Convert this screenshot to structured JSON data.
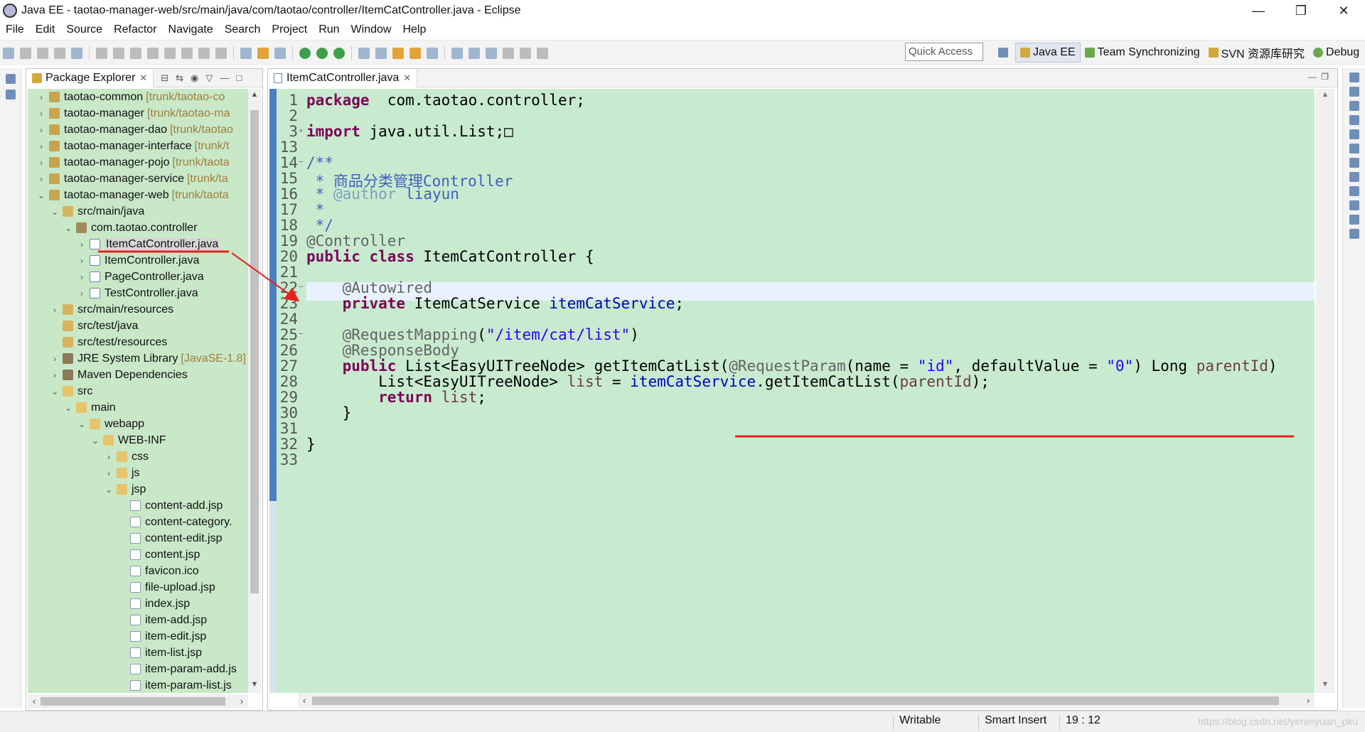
{
  "window": {
    "title": "Java EE - taotao-manager-web/src/main/java/com/taotao/controller/ItemCatController.java - Eclipse",
    "minimize": "—",
    "restore": "❐",
    "close": "✕"
  },
  "menu": [
    "File",
    "Edit",
    "Source",
    "Refactor",
    "Navigate",
    "Search",
    "Project",
    "Run",
    "Window",
    "Help"
  ],
  "quick_access": {
    "placeholder": "Quick Access"
  },
  "perspectives": [
    "Java EE",
    "Team Synchronizing",
    "SVN 资源库研究",
    "Debug"
  ],
  "package_explorer": {
    "title": "Package Explorer",
    "rows": [
      {
        "label": "taotao-common",
        "deco": "[trunk/taotao-co",
        "icon": "project",
        "arrow": "›"
      },
      {
        "label": "taotao-manager",
        "deco": "[trunk/taotao-ma",
        "icon": "project",
        "arrow": "›"
      },
      {
        "label": "taotao-manager-dao",
        "deco": "[trunk/taotao",
        "icon": "project",
        "arrow": "›"
      },
      {
        "label": "taotao-manager-interface",
        "deco": "[trunk/t",
        "icon": "project",
        "arrow": "›"
      },
      {
        "label": "taotao-manager-pojo",
        "deco": "[trunk/taota",
        "icon": "project",
        "arrow": "›"
      },
      {
        "label": "taotao-manager-service",
        "deco": "[trunk/ta",
        "icon": "project",
        "arrow": "›"
      },
      {
        "label": "taotao-manager-web",
        "deco": "[trunk/taota",
        "icon": "project",
        "arrow": "⌄"
      },
      {
        "label": "src/main/java",
        "deco": "",
        "icon": "srcfolder",
        "arrow": "⌄"
      },
      {
        "label": "com.taotao.controller",
        "deco": "",
        "icon": "package",
        "arrow": "⌄"
      },
      {
        "label": "ItemCatController.java",
        "deco": "",
        "icon": "java",
        "arrow": "›"
      },
      {
        "label": "ItemController.java",
        "deco": "",
        "icon": "java",
        "arrow": "›"
      },
      {
        "label": "PageController.java",
        "deco": "",
        "icon": "java",
        "arrow": "›"
      },
      {
        "label": "TestController.java",
        "deco": "",
        "icon": "java",
        "arrow": "›"
      },
      {
        "label": "src/main/resources",
        "deco": "",
        "icon": "srcfolder",
        "arrow": "›"
      },
      {
        "label": "src/test/java",
        "deco": "",
        "icon": "srcfolder",
        "arrow": ""
      },
      {
        "label": "src/test/resources",
        "deco": "",
        "icon": "srcfolder",
        "arrow": ""
      },
      {
        "label": "JRE System Library",
        "deco": "[JavaSE-1.8]",
        "icon": "lib",
        "arrow": "›"
      },
      {
        "label": "Maven Dependencies",
        "deco": "",
        "icon": "lib",
        "arrow": "›"
      },
      {
        "label": "src",
        "deco": "",
        "icon": "folder",
        "arrow": "⌄"
      },
      {
        "label": "main",
        "deco": "",
        "icon": "folder",
        "arrow": "⌄"
      },
      {
        "label": "webapp",
        "deco": "",
        "icon": "folder",
        "arrow": "⌄"
      },
      {
        "label": "WEB-INF",
        "deco": "",
        "icon": "folder",
        "arrow": "⌄"
      },
      {
        "label": "css",
        "deco": "",
        "icon": "folder",
        "arrow": "›"
      },
      {
        "label": "js",
        "deco": "",
        "icon": "folder",
        "arrow": "›"
      },
      {
        "label": "jsp",
        "deco": "",
        "icon": "folder",
        "arrow": "⌄"
      },
      {
        "label": "content-add.jsp",
        "deco": "",
        "icon": "file",
        "arrow": ""
      },
      {
        "label": "content-category.",
        "deco": "",
        "icon": "file",
        "arrow": ""
      },
      {
        "label": "content-edit.jsp",
        "deco": "",
        "icon": "file",
        "arrow": ""
      },
      {
        "label": "content.jsp",
        "deco": "",
        "icon": "file",
        "arrow": ""
      },
      {
        "label": "favicon.ico",
        "deco": "",
        "icon": "file",
        "arrow": ""
      },
      {
        "label": "file-upload.jsp",
        "deco": "",
        "icon": "file",
        "arrow": ""
      },
      {
        "label": "index.jsp",
        "deco": "",
        "icon": "file",
        "arrow": ""
      },
      {
        "label": "item-add.jsp",
        "deco": "",
        "icon": "file",
        "arrow": ""
      },
      {
        "label": "item-edit.jsp",
        "deco": "",
        "icon": "file",
        "arrow": ""
      },
      {
        "label": "item-list.jsp",
        "deco": "",
        "icon": "file",
        "arrow": ""
      },
      {
        "label": "item-param-add.js",
        "deco": "",
        "icon": "file",
        "arrow": ""
      },
      {
        "label": "item-param-list.js",
        "deco": "",
        "icon": "file",
        "arrow": ""
      }
    ]
  },
  "editor": {
    "tab": "ItemCatController.java",
    "lines": [
      {
        "n": "1",
        "fold": "",
        "parts": [
          [
            "kw",
            "package"
          ],
          [
            "",
            "  com.taotao.controller;"
          ]
        ]
      },
      {
        "n": "2",
        "fold": "",
        "parts": []
      },
      {
        "n": "3",
        "fold": "+",
        "parts": [
          [
            "kw",
            "import"
          ],
          [
            "",
            " java.util.List;"
          ],
          [
            "",
            "□"
          ]
        ]
      },
      {
        "n": "13",
        "fold": "",
        "parts": []
      },
      {
        "n": "14",
        "fold": "−",
        "parts": [
          [
            "cmt",
            "/**"
          ]
        ]
      },
      {
        "n": "15",
        "fold": "",
        "parts": [
          [
            "cmt",
            " * 商品分类管理Controller"
          ]
        ]
      },
      {
        "n": "16",
        "fold": "",
        "parts": [
          [
            "cmt",
            " * "
          ],
          [
            "jdoc",
            "@author"
          ],
          [
            "cmt",
            " liayun"
          ]
        ]
      },
      {
        "n": "17",
        "fold": "",
        "parts": [
          [
            "cmt",
            " *"
          ]
        ]
      },
      {
        "n": "18",
        "fold": "",
        "parts": [
          [
            "cmt",
            " */"
          ]
        ]
      },
      {
        "n": "19",
        "fold": "",
        "parts": [
          [
            "ann",
            "@Controller"
          ]
        ]
      },
      {
        "n": "20",
        "fold": "",
        "parts": [
          [
            "kw",
            "public"
          ],
          [
            "",
            " "
          ],
          [
            "kw",
            "class"
          ],
          [
            "",
            " ItemCatController {"
          ]
        ]
      },
      {
        "n": "21",
        "fold": "",
        "parts": []
      },
      {
        "n": "22",
        "fold": "−",
        "parts": [
          [
            "",
            "    "
          ],
          [
            "ann",
            "@Autowired"
          ]
        ]
      },
      {
        "n": "23",
        "fold": "",
        "parts": [
          [
            "",
            "    "
          ],
          [
            "kw",
            "private"
          ],
          [
            "",
            " ItemCatService "
          ],
          [
            "fld",
            "itemCatService"
          ],
          [
            "",
            ";"
          ]
        ]
      },
      {
        "n": "24",
        "fold": "",
        "parts": []
      },
      {
        "n": "25",
        "fold": "−",
        "parts": [
          [
            "",
            "    "
          ],
          [
            "ann",
            "@RequestMapping"
          ],
          [
            "",
            "("
          ],
          [
            "str",
            "\"/item/cat/list\""
          ],
          [
            "",
            ")"
          ]
        ]
      },
      {
        "n": "26",
        "fold": "",
        "parts": [
          [
            "",
            "    "
          ],
          [
            "ann",
            "@ResponseBody"
          ]
        ]
      },
      {
        "n": "27",
        "fold": "",
        "parts": [
          [
            "",
            "    "
          ],
          [
            "kw",
            "public"
          ],
          [
            "",
            " List<EasyUITreeNode> getItemCatList("
          ],
          [
            "ann",
            "@RequestParam"
          ],
          [
            "",
            "(name = "
          ],
          [
            "str",
            "\"id\""
          ],
          [
            "",
            ", defaultValue = "
          ],
          [
            "str",
            "\"0\""
          ],
          [
            "",
            ") Long "
          ],
          [
            "var",
            "parentId"
          ],
          [
            "",
            ")"
          ]
        ]
      },
      {
        "n": "28",
        "fold": "",
        "parts": [
          [
            "",
            "        List<EasyUITreeNode> "
          ],
          [
            "var",
            "list"
          ],
          [
            "",
            " = "
          ],
          [
            "fld",
            "itemCatService"
          ],
          [
            "",
            ".getItemCatList("
          ],
          [
            "var",
            "parentId"
          ],
          [
            "",
            ");"
          ]
        ]
      },
      {
        "n": "29",
        "fold": "",
        "parts": [
          [
            "",
            "        "
          ],
          [
            "kw",
            "return"
          ],
          [
            "",
            " "
          ],
          [
            "var",
            "list"
          ],
          [
            "",
            ";"
          ]
        ]
      },
      {
        "n": "30",
        "fold": "",
        "parts": [
          [
            "",
            "    }"
          ]
        ]
      },
      {
        "n": "31",
        "fold": "",
        "parts": []
      },
      {
        "n": "32",
        "fold": "",
        "parts": [
          [
            "",
            "}"
          ]
        ]
      },
      {
        "n": "33",
        "fold": "",
        "parts": []
      }
    ]
  },
  "status": {
    "mode": "Writable",
    "insert": "Smart Insert",
    "position": "19 : 12",
    "watermark": "https://blog.csdn.net/yerenyuan_pku"
  },
  "colors": {
    "editor_bg": "#c8ebd0",
    "tree_bg": "#c8e8c8",
    "annotation_red": "#e8201e",
    "keyword": "#7f0055",
    "string": "#2a00ff"
  }
}
